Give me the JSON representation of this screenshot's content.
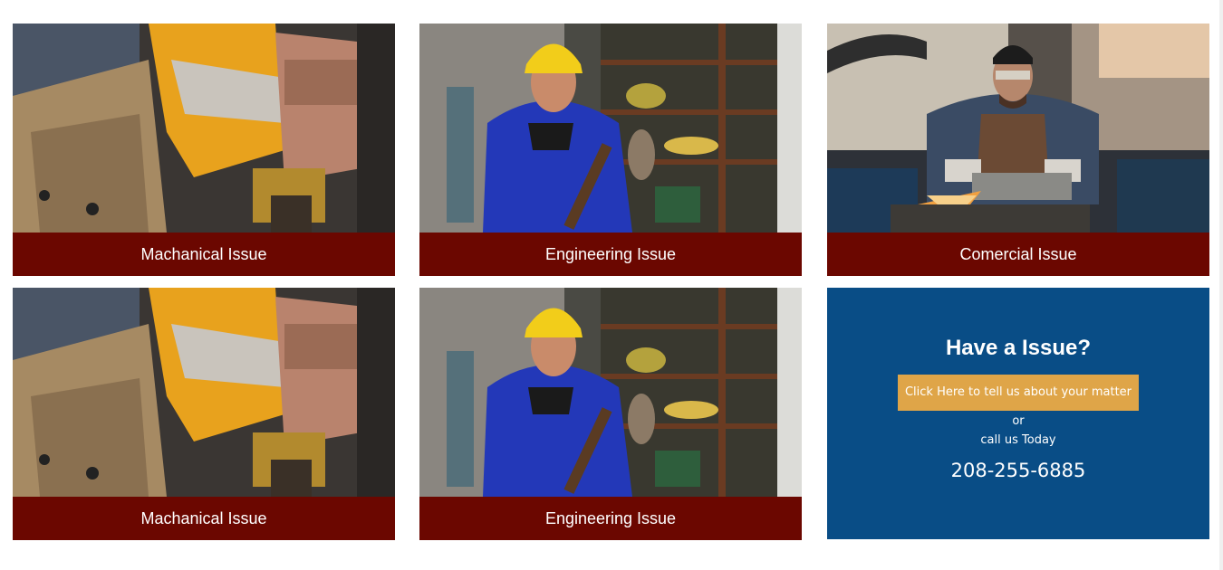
{
  "cards": [
    {
      "caption": "Machanical Issue",
      "image": "gloved-hands-drill-photo"
    },
    {
      "caption": "Engineering Issue",
      "image": "worker-hard-hat-hammer-photo"
    },
    {
      "caption": "Comercial Issue",
      "image": "welder-grinding-sparks-photo"
    },
    {
      "caption": "Machanical Issue",
      "image": "gloved-hands-drill-photo"
    },
    {
      "caption": "Engineering Issue",
      "image": "worker-hard-hat-hammer-photo"
    }
  ],
  "cta": {
    "heading": "Have a Issue?",
    "button_label": "Click Here to tell us about your matter",
    "or_text": "or",
    "call_text": "call us Today",
    "phone": "208-255-6885"
  },
  "colors": {
    "caption_bg": "#6b0700",
    "cta_bg": "#094d86",
    "cta_button": "#dfa548"
  }
}
